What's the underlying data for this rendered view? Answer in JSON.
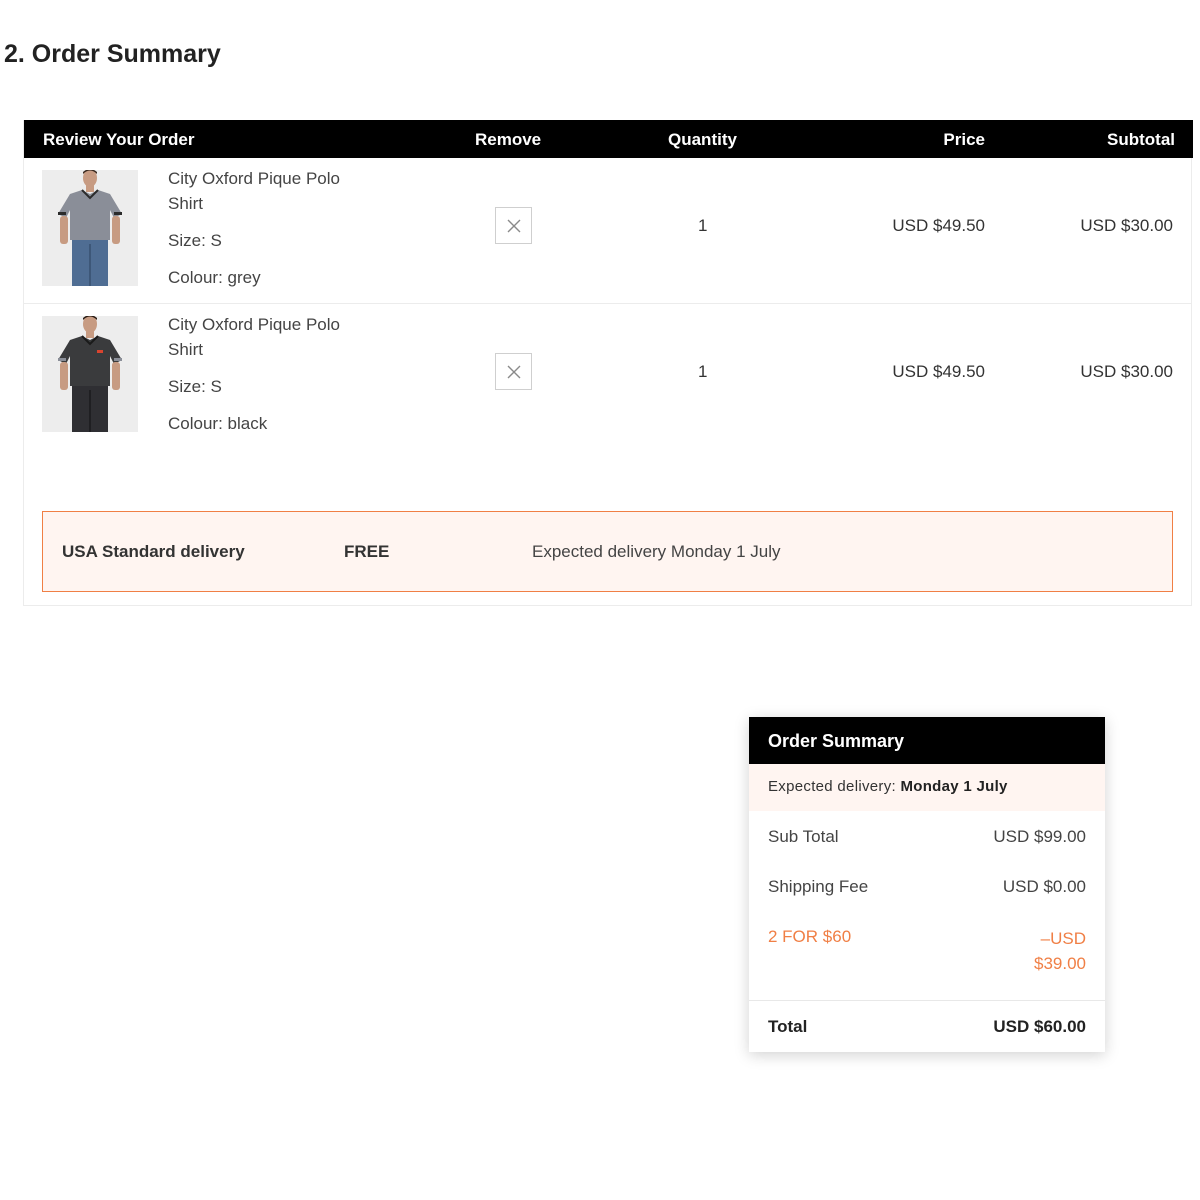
{
  "section_title": "2. Order Summary",
  "review_table": {
    "headers": {
      "review": "Review Your Order",
      "remove": "Remove",
      "quantity": "Quantity",
      "price": "Price",
      "subtotal": "Subtotal"
    },
    "items": [
      {
        "name": "City Oxford Pique Polo Shirt",
        "size": "Size: S",
        "colour": "Colour: grey",
        "quantity": "1",
        "price": "USD $49.50",
        "subtotal": "USD $30.00",
        "shirt_color": "#8a8e98"
      },
      {
        "name": "City Oxford Pique Polo Shirt",
        "size": "Size: S",
        "colour": "Colour: black",
        "quantity": "1",
        "price": "USD $49.50",
        "subtotal": "USD $30.00",
        "shirt_color": "#3a3b3d"
      }
    ],
    "delivery": {
      "name": "USA Standard delivery",
      "cost": "FREE",
      "expected": "Expected delivery Monday 1 July"
    }
  },
  "order_summary": {
    "title": "Order Summary",
    "expected_label": "Expected delivery:",
    "expected_value": "Monday 1 July",
    "sub_total_label": "Sub Total",
    "sub_total_value": "USD $99.00",
    "shipping_label": "Shipping Fee",
    "shipping_value": "USD $0.00",
    "promo_label": "2 FOR $60",
    "promo_value": "–USD $39.00",
    "total_label": "Total",
    "total_value": "USD $60.00"
  },
  "colors": {
    "accent": "#f07f45",
    "header_bg": "#000000",
    "highlight_bg": "#fff5f1"
  }
}
